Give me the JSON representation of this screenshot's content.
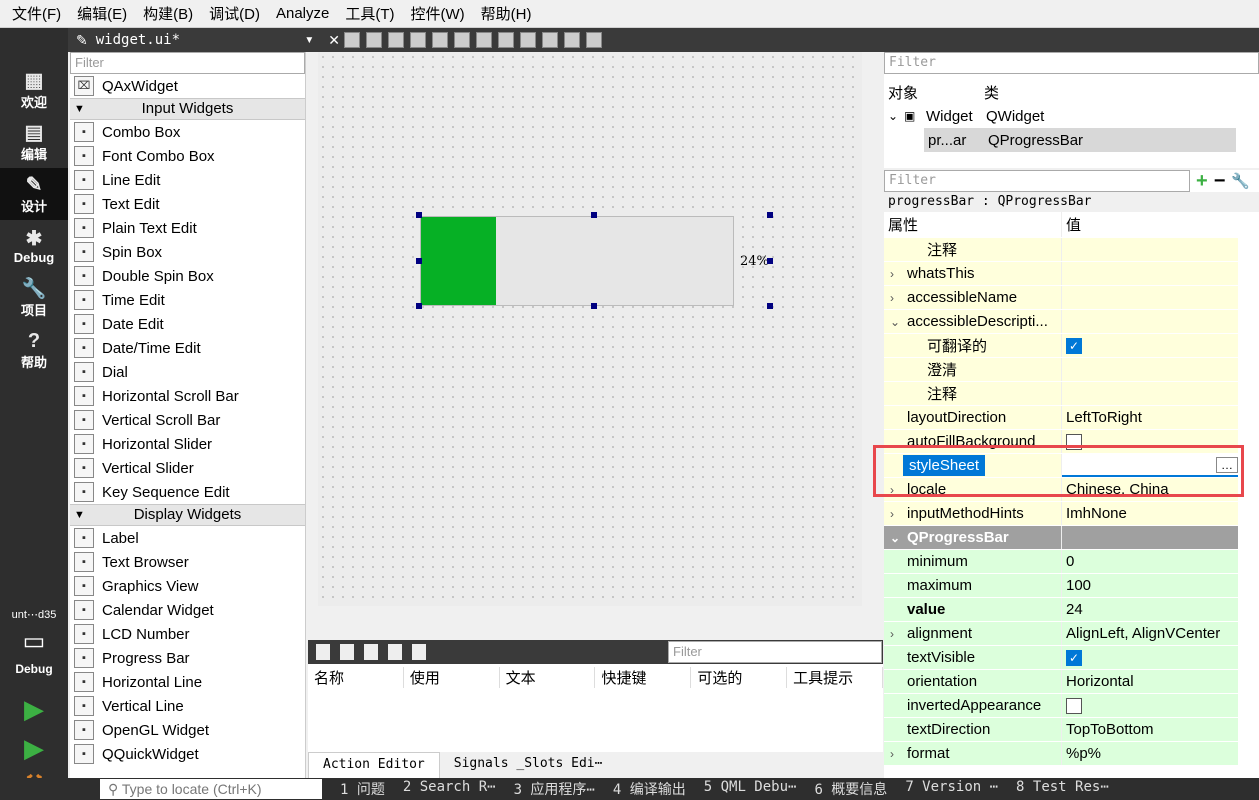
{
  "menu": [
    "文件(F)",
    "编辑(E)",
    "构建(B)",
    "调试(D)",
    "Analyze",
    "工具(T)",
    "控件(W)",
    "帮助(H)"
  ],
  "modes": [
    {
      "label": "欢迎",
      "icon": "grid-icon"
    },
    {
      "label": "编辑",
      "icon": "edit-icon"
    },
    {
      "label": "设计",
      "icon": "pencil-icon"
    },
    {
      "label": "Debug",
      "icon": "bug-icon"
    },
    {
      "label": "项目",
      "icon": "wrench-icon"
    },
    {
      "label": "帮助",
      "icon": "help-icon"
    }
  ],
  "kit": {
    "name": "unt⋯d35",
    "mode": "Debug"
  },
  "doc": {
    "filename": "widget.ui*"
  },
  "widgetbox": {
    "filter_placeholder": "Filter",
    "top_item": "QAxWidget",
    "input_header": "Input Widgets",
    "input_items": [
      "Combo Box",
      "Font Combo Box",
      "Line Edit",
      "Text Edit",
      "Plain Text Edit",
      "Spin Box",
      "Double Spin Box",
      "Time Edit",
      "Date Edit",
      "Date/Time Edit",
      "Dial",
      "Horizontal Scroll Bar",
      "Vertical Scroll Bar",
      "Horizontal Slider",
      "Vertical Slider",
      "Key Sequence Edit"
    ],
    "display_header": "Display Widgets",
    "display_items": [
      "Label",
      "Text Browser",
      "Graphics View",
      "Calendar Widget",
      "LCD Number",
      "Progress Bar",
      "Horizontal Line",
      "Vertical Line",
      "OpenGL Widget",
      "QQuickWidget"
    ]
  },
  "canvas": {
    "progress_value": 0.24,
    "progress_text": "24%",
    "fill_color": "#06b025"
  },
  "action_editor": {
    "filter_placeholder": "Filter",
    "columns": [
      "名称",
      "使用",
      "文本",
      "快捷键",
      "可选的",
      "工具提示"
    ],
    "tabs": [
      "Action Editor",
      "Signals _Slots Edi⋯"
    ]
  },
  "object_inspector": {
    "filter_placeholder": "Filter",
    "col_object": "对象",
    "col_class": "类",
    "rows": [
      {
        "name": "Widget",
        "cls": "QWidget"
      },
      {
        "name": "pr...ar",
        "cls": "QProgressBar"
      }
    ]
  },
  "property_editor": {
    "filter_placeholder": "Filter",
    "class_line": "progressBar : QProgressBar",
    "col_prop": "属性",
    "col_value": "值",
    "rows": [
      {
        "k": "注释",
        "v": "",
        "sub": true
      },
      {
        "k": "whatsThis",
        "v": "",
        "exp": "›"
      },
      {
        "k": "accessibleName",
        "v": "",
        "exp": "›"
      },
      {
        "k": "accessibleDescripti...",
        "v": "",
        "exp": "⌄"
      },
      {
        "k": "可翻译的",
        "v": "",
        "sub": true,
        "check": true
      },
      {
        "k": "澄清",
        "v": "",
        "sub": true
      },
      {
        "k": "注释",
        "v": "",
        "sub": true
      },
      {
        "k": "layoutDirection",
        "v": "LeftToRight"
      },
      {
        "k": "autoFillBackground",
        "v": "",
        "check": false
      },
      {
        "k": "styleSheet",
        "v": "",
        "sel": true
      },
      {
        "k": "locale",
        "v": "Chinese, China",
        "exp": "›"
      },
      {
        "k": "inputMethodHints",
        "v": "ImhNone",
        "exp": "›"
      }
    ],
    "group": "QProgressBar",
    "rows2": [
      {
        "k": "minimum",
        "v": "0"
      },
      {
        "k": "maximum",
        "v": "100"
      },
      {
        "k": "value",
        "v": "24",
        "bold": true
      },
      {
        "k": "alignment",
        "v": "AlignLeft, AlignVCenter",
        "exp": "›"
      },
      {
        "k": "textVisible",
        "v": "",
        "check": true
      },
      {
        "k": "orientation",
        "v": "Horizontal"
      },
      {
        "k": "invertedAppearance",
        "v": "",
        "check": false
      },
      {
        "k": "textDirection",
        "v": "TopToBottom"
      },
      {
        "k": "format",
        "v": "%p%",
        "exp": "›"
      }
    ]
  },
  "status": {
    "locate_placeholder": "Type to locate (Ctrl+K)",
    "items": [
      "1 问题",
      "2 Search R⋯",
      "3 应用程序⋯",
      "4 编译输出",
      "5 QML Debu⋯",
      "6 概要信息",
      "7 Version ⋯",
      "8 Test Res⋯"
    ]
  }
}
